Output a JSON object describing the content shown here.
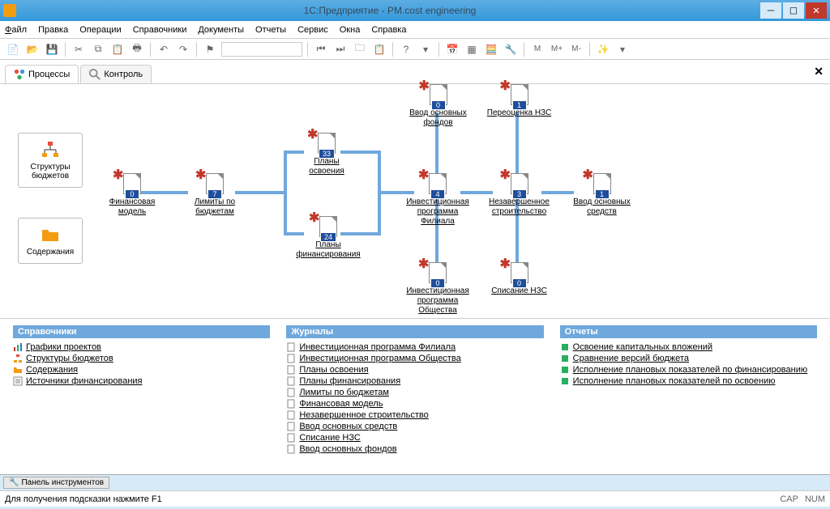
{
  "title": "1С:Предприятие - PM.cost engineering",
  "menu": {
    "file": "Файл",
    "edit": "Правка",
    "ops": "Операции",
    "ref": "Справочники",
    "docs": "Документы",
    "rep": "Отчеты",
    "svc": "Сервис",
    "win": "Окна",
    "help": "Справка"
  },
  "tabs": {
    "t1": "Процессы",
    "t2": "Контроль"
  },
  "side": {
    "p1": "Структуры бюджетов",
    "p2": "Содержания"
  },
  "nodes": {
    "n1": {
      "label": "Финансовая модель",
      "count": "0"
    },
    "n2": {
      "label": "Лимиты по бюджетам",
      "count": "7"
    },
    "n3": {
      "label": "Планы освоения",
      "count": "33"
    },
    "n4": {
      "label": "Планы финансирования",
      "count": "24"
    },
    "n5": {
      "label": "Инвестиционная программа Филиала",
      "count": "4"
    },
    "n6": {
      "label": "Ввод основных фондов",
      "count": "0"
    },
    "n7": {
      "label": "Переоценка НЗС",
      "count": "1"
    },
    "n8": {
      "label": "Незавершенное строительство",
      "count": "3"
    },
    "n9": {
      "label": "Ввод основных средств",
      "count": "1"
    },
    "n10": {
      "label": "Инвестиционная программа Общества",
      "count": "0"
    },
    "n11": {
      "label": "Списание НЗС",
      "count": "0"
    }
  },
  "lists": {
    "h1": "Справочники",
    "h2": "Журналы",
    "h3": "Отчеты",
    "c1": [
      "Графики проектов",
      "Структуры бюджетов",
      "Содержания",
      "Источники финансирования"
    ],
    "c2": [
      "Инвестиционная программа Филиала",
      "Инвестиционная программа Общества",
      "Планы освоения",
      "Планы финансирования",
      "Лимиты по бюджетам",
      "Финансовая модель",
      "Незавершенное строительство",
      "Ввод основных средств",
      "Списание НЗС",
      "Ввод основных фондов"
    ],
    "c3": [
      "Освоение капитальных вложений",
      "Сравнение версий бюджета",
      "Исполнение плановых показателей по финансированию",
      "Исполнение плановых показателей по освоению"
    ]
  },
  "status": {
    "panel": "Панель инструментов",
    "hint": "Для получения подсказки нажмите F1",
    "cap": "CAP",
    "num": "NUM"
  }
}
